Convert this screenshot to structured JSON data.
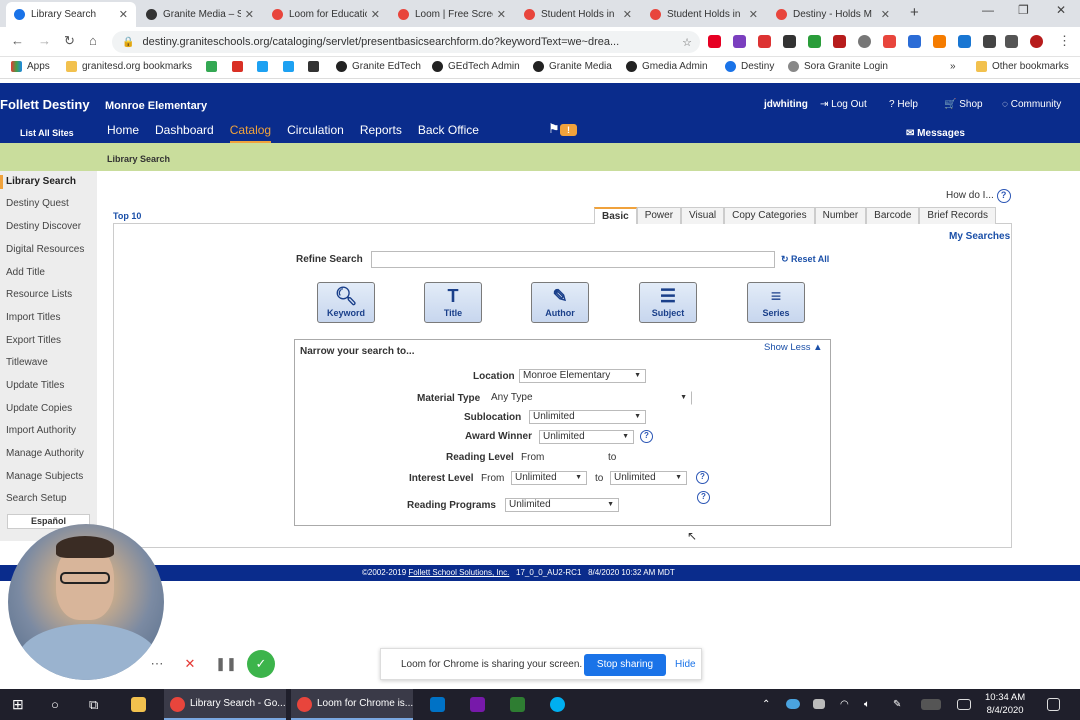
{
  "browser": {
    "tabs": [
      {
        "label": "Library Search",
        "color": "#1a73e8",
        "active": true
      },
      {
        "label": "Granite Media – S",
        "color": "#333333"
      },
      {
        "label": "Loom for Educatio",
        "color": "#e8453c"
      },
      {
        "label": "Loom | Free Scree",
        "color": "#e8453c"
      },
      {
        "label": "Student Holds in",
        "color": "#e8453c"
      },
      {
        "label": "Student Holds in",
        "color": "#e8453c"
      },
      {
        "label": "Destiny - Holds M",
        "color": "#e8453c"
      }
    ],
    "url": "destiny.graniteschools.org/cataloging/servlet/presentbasicsearchform.do?keywordText=we~drea...",
    "bookmarks": [
      "Apps",
      "granitesd.org bookmarks",
      "Granite EdTech",
      "GEdTech Admin",
      "Granite Media",
      "Gmedia Admin",
      "Destiny",
      "Sora Granite Login",
      "Other bookmarks"
    ]
  },
  "header": {
    "brand": "Follett Destiny",
    "school": "Monroe Elementary",
    "list_all_sites": "List All Sites",
    "nav": [
      "Home",
      "Dashboard",
      "Catalog",
      "Circulation",
      "Reports",
      "Back Office"
    ],
    "active_nav": "Catalog",
    "flag_badge": "!",
    "user": "jdwhiting",
    "logout": "Log Out",
    "help": "Help",
    "shop": "Shop",
    "community": "Community",
    "messages": "Messages"
  },
  "subheader": {
    "title": "Library Search"
  },
  "sidebar": {
    "items": [
      "Library Search",
      "Destiny Quest",
      "Destiny Discover",
      "Digital Resources",
      "Add Title",
      "Resource Lists",
      "Import Titles",
      "Export Titles",
      "Titlewave",
      "Update Titles",
      "Update Copies",
      "Import Authority",
      "Manage Authority",
      "Manage Subjects",
      "Search Setup"
    ],
    "language_button": "Español"
  },
  "content": {
    "how_do_i": "How do I...",
    "top10": "Top 10",
    "search_tabs": [
      "Basic",
      "Power",
      "Visual",
      "Copy Categories",
      "Number",
      "Barcode",
      "Brief Records"
    ],
    "active_tab": "Basic",
    "my_searches": "My Searches",
    "refine_label": "Refine Search",
    "refine_value": "",
    "reset_all": "Reset All",
    "search_buttons": [
      "Keyword",
      "Title",
      "Author",
      "Subject",
      "Series"
    ],
    "narrow_title": "Narrow your search to...",
    "show_less": "Show Less",
    "filters": {
      "location_label": "Location",
      "location_value": "Monroe Elementary",
      "material_label": "Material Type",
      "material_value": "Any Type",
      "sublocation_label": "Sublocation",
      "sublocation_value": "Unlimited",
      "award_label": "Award Winner",
      "award_value": "Unlimited",
      "reading_level_label": "Reading Level",
      "reading_from": "From",
      "reading_to": "to",
      "interest_label": "Interest Level",
      "interest_from_text": "From",
      "interest_from_value": "Unlimited",
      "interest_to_text": "to",
      "interest_to_value": "Unlimited",
      "programs_label": "Reading Programs",
      "programs_value": "Unlimited"
    }
  },
  "footer": {
    "copyright": "©2002-2019",
    "company": "Follett School Solutions, Inc.",
    "version": "17_0_0_AU2-RC1",
    "timestamp": "8/4/2020 10:32 AM MDT"
  },
  "loom": {
    "share_message": "Loom for Chrome is sharing your screen.",
    "stop_sharing": "Stop sharing",
    "hide": "Hide"
  },
  "taskbar": {
    "apps": [
      "Library Search - Go...",
      "Loom for Chrome is..."
    ],
    "time": "10:34 AM",
    "date": "8/4/2020"
  }
}
